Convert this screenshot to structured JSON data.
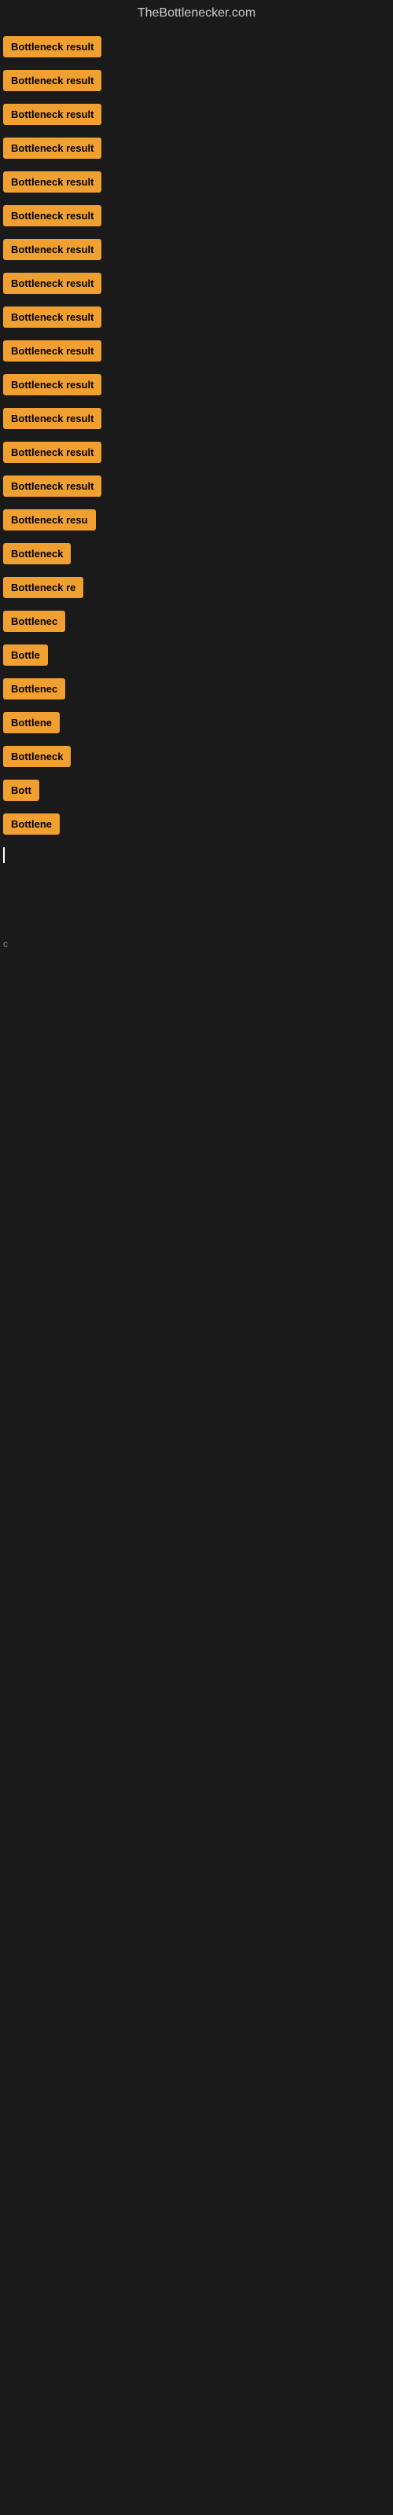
{
  "site": {
    "title": "TheBottlenecker.com"
  },
  "rows": [
    {
      "label": "Bottleneck result",
      "truncated": false,
      "visible": true
    },
    {
      "label": "Bottleneck result",
      "truncated": false,
      "visible": true
    },
    {
      "label": "Bottleneck result",
      "truncated": false,
      "visible": true
    },
    {
      "label": "Bottleneck result",
      "truncated": false,
      "visible": true
    },
    {
      "label": "Bottleneck result",
      "truncated": false,
      "visible": true
    },
    {
      "label": "Bottleneck result",
      "truncated": false,
      "visible": true
    },
    {
      "label": "Bottleneck result",
      "truncated": false,
      "visible": true
    },
    {
      "label": "Bottleneck result",
      "truncated": false,
      "visible": true
    },
    {
      "label": "Bottleneck result",
      "truncated": false,
      "visible": true
    },
    {
      "label": "Bottleneck result",
      "truncated": false,
      "visible": true
    },
    {
      "label": "Bottleneck result",
      "truncated": false,
      "visible": true
    },
    {
      "label": "Bottleneck result",
      "truncated": false,
      "visible": true
    },
    {
      "label": "Bottleneck result",
      "truncated": false,
      "visible": true
    },
    {
      "label": "Bottleneck result",
      "truncated": false,
      "visible": true
    },
    {
      "label": "Bottleneck resu",
      "truncated": true,
      "visible": true
    },
    {
      "label": "Bottleneck",
      "truncated": true,
      "visible": true
    },
    {
      "label": "Bottleneck re",
      "truncated": true,
      "visible": true
    },
    {
      "label": "Bottlenec",
      "truncated": true,
      "visible": true
    },
    {
      "label": "Bottle",
      "truncated": true,
      "visible": true
    },
    {
      "label": "Bottlenec",
      "truncated": true,
      "visible": true
    },
    {
      "label": "Bottlene",
      "truncated": true,
      "visible": true
    },
    {
      "label": "Bottleneck",
      "truncated": true,
      "visible": true
    },
    {
      "label": "Bott",
      "truncated": true,
      "visible": true
    },
    {
      "label": "Bottlene",
      "truncated": true,
      "visible": true
    },
    {
      "label": "|",
      "truncated": false,
      "cursor": true,
      "visible": true
    },
    {
      "label": "",
      "visible": false
    },
    {
      "label": "",
      "visible": false
    },
    {
      "label": "",
      "visible": false
    },
    {
      "label": "",
      "visible": false
    },
    {
      "label": "",
      "visible": false
    },
    {
      "label": "c",
      "small": true,
      "visible": true
    },
    {
      "label": "",
      "visible": false
    },
    {
      "label": "",
      "visible": false
    },
    {
      "label": "",
      "visible": false
    },
    {
      "label": "",
      "visible": false
    },
    {
      "label": "",
      "visible": false
    },
    {
      "label": "",
      "visible": false
    },
    {
      "label": "",
      "visible": false
    },
    {
      "label": "",
      "visible": false
    },
    {
      "label": "",
      "visible": false
    }
  ]
}
